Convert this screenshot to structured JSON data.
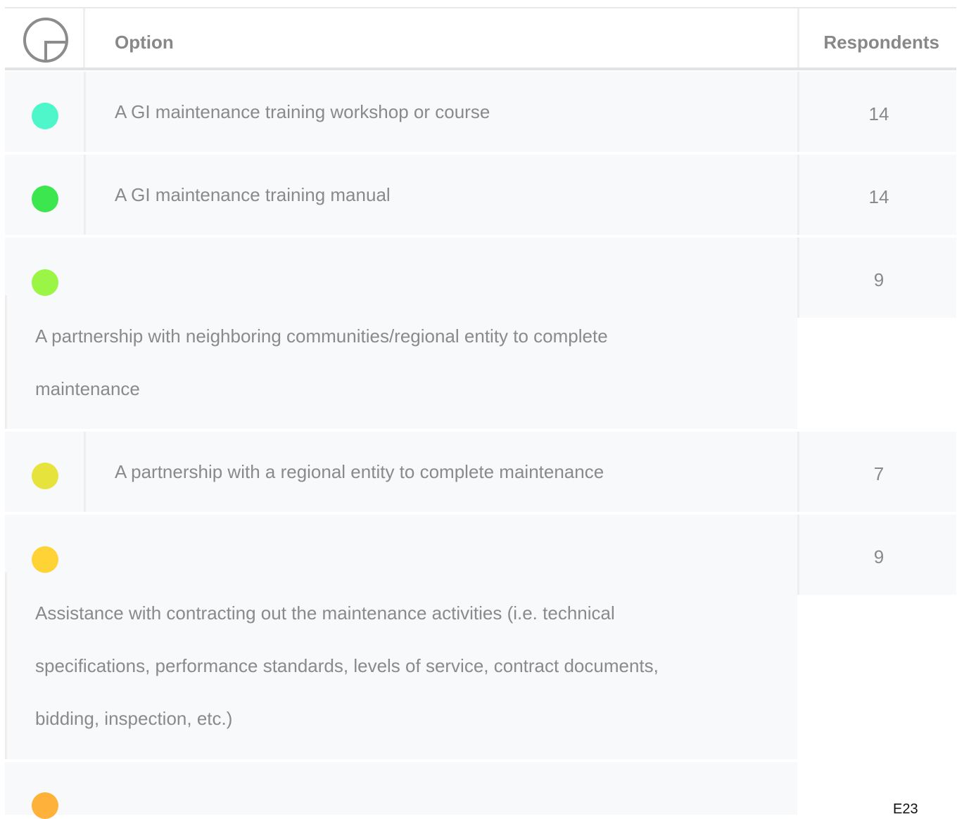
{
  "header": {
    "option_label": "Option",
    "respondents_label": "Respondents",
    "logo_icon": "circle-corner-logo-icon"
  },
  "rows": [
    {
      "option": "A GI maintenance training workshop or course",
      "respondents": "14",
      "color": "#4ef7c9"
    },
    {
      "option": "A GI maintenance training manual",
      "respondents": "14",
      "color": "#3be64f"
    },
    {
      "option_lines": [
        "A partnership with neighboring communities/regional entity to complete",
        "maintenance"
      ],
      "respondents": "9",
      "color": "#9af545"
    },
    {
      "option": "A partnership with a regional entity to complete maintenance",
      "respondents": "7",
      "color": "#e5e33c"
    },
    {
      "option_lines": [
        "Assistance with contracting out the maintenance activities (i.e. technical",
        "specifications, performance standards, levels of service, contract documents,",
        "bidding, inspection, etc.)"
      ],
      "respondents": "9",
      "color": "#ffd335"
    },
    {
      "color": "#ffb23b"
    }
  ],
  "footer": {
    "page_id": "E23"
  }
}
